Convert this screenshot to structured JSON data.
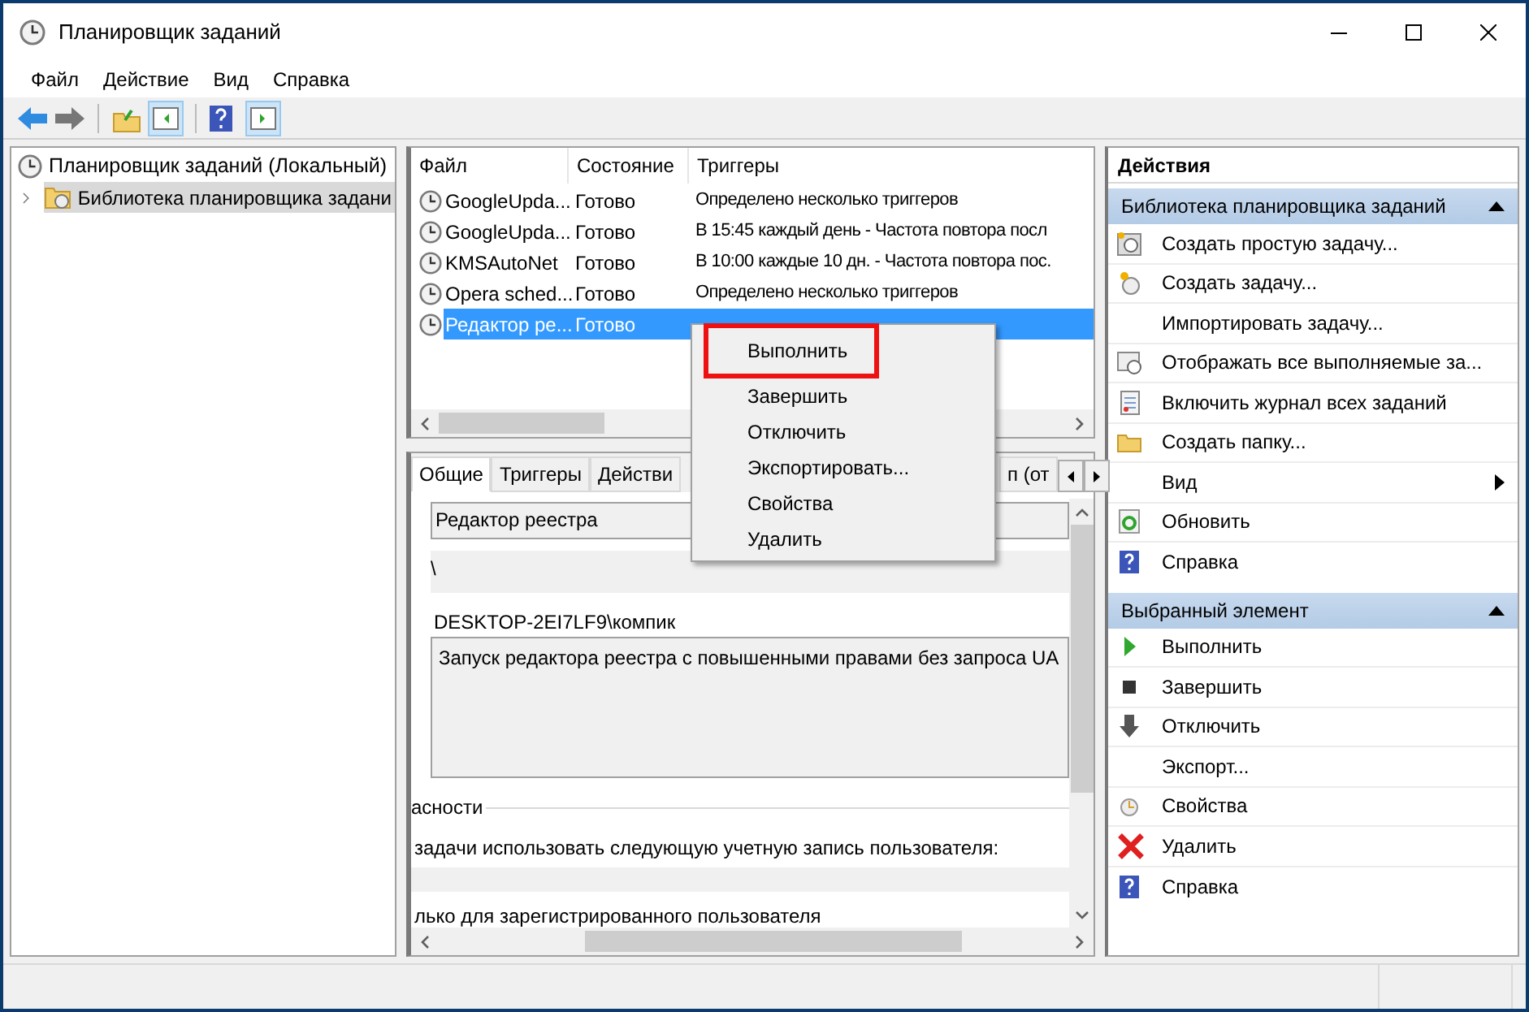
{
  "window": {
    "title": "Планировщик заданий"
  },
  "menu": [
    "Файл",
    "Действие",
    "Вид",
    "Справка"
  ],
  "tree": [
    {
      "label": "Планировщик заданий (Локальный)",
      "selected": false,
      "children": [
        {
          "label": "Библиотека планировщика задани",
          "selected": true,
          "expanded": false
        }
      ]
    }
  ],
  "task_list": {
    "columns": [
      "Файл",
      "Состояние",
      "Триггеры"
    ],
    "rows": [
      {
        "name": "GoogleUpda...",
        "status": "Готово",
        "triggers": "Определено несколько триггеров",
        "selected": false
      },
      {
        "name": "GoogleUpda...",
        "status": "Готово",
        "triggers": "В 15:45 каждый день - Частота повтора посл",
        "selected": false
      },
      {
        "name": "KMSAutoNet",
        "status": "Готово",
        "triggers": "В 10:00 каждые 10 дн. - Частота повтора пос.",
        "selected": false
      },
      {
        "name": "Opera sched...",
        "status": "Готово",
        "triggers": "Определено несколько триггеров",
        "selected": false
      },
      {
        "name": "Редактор ре...",
        "status": "Готово",
        "triggers": "",
        "selected": true
      }
    ]
  },
  "context_menu": [
    {
      "label": "Выполнить",
      "annotated": true
    },
    {
      "label": "Завершить",
      "annotated": false
    },
    {
      "label": "Отключить",
      "annotated": false
    },
    {
      "label": "Экспортировать...",
      "annotated": false
    },
    {
      "label": "Свойства",
      "annotated": false
    },
    {
      "label": "Удалить",
      "annotated": false
    }
  ],
  "details": {
    "tabs": [
      {
        "label": "Общие",
        "selected": true
      },
      {
        "label": "Триггеры",
        "selected": false
      },
      {
        "label": "Действи",
        "selected": false
      },
      {
        "label": "п (от",
        "selected": false
      }
    ],
    "name_value": "Редактор реестра",
    "location": "\\",
    "author": "DESKTOP-2EI7LF9\\компик",
    "description": "Запуск редактора реестра с повышенными правами без запроса UA",
    "security_heading": "асности",
    "account_text": "задачи использовать следующую учетную запись пользователя:",
    "option_text": "лько для зарегистрированного пользователя"
  },
  "actions": {
    "title": "Действия",
    "sections": [
      {
        "title": "Библиотека планировщика заданий",
        "expanded": true,
        "items": [
          {
            "label": "Создать простую задачу...",
            "submenu": false
          },
          {
            "label": "Создать задачу...",
            "submenu": false
          },
          {
            "label": "Импортировать задачу...",
            "submenu": false
          },
          {
            "label": "Отображать все выполняемые за...",
            "submenu": false
          },
          {
            "label": "Включить журнал всех заданий",
            "submenu": false
          },
          {
            "label": "Создать папку...",
            "submenu": false
          },
          {
            "label": "Вид",
            "submenu": true
          },
          {
            "label": "Обновить",
            "submenu": false
          },
          {
            "label": "Справка",
            "submenu": false
          }
        ]
      },
      {
        "title": "Выбранный элемент",
        "expanded": true,
        "items": [
          {
            "label": "Выполнить",
            "submenu": false
          },
          {
            "label": "Завершить",
            "submenu": false
          },
          {
            "label": "Отключить",
            "submenu": false
          },
          {
            "label": "Экспорт...",
            "submenu": false
          },
          {
            "label": "Свойства",
            "submenu": false
          },
          {
            "label": "Удалить",
            "submenu": false
          },
          {
            "label": "Справка",
            "submenu": false
          }
        ]
      }
    ]
  }
}
